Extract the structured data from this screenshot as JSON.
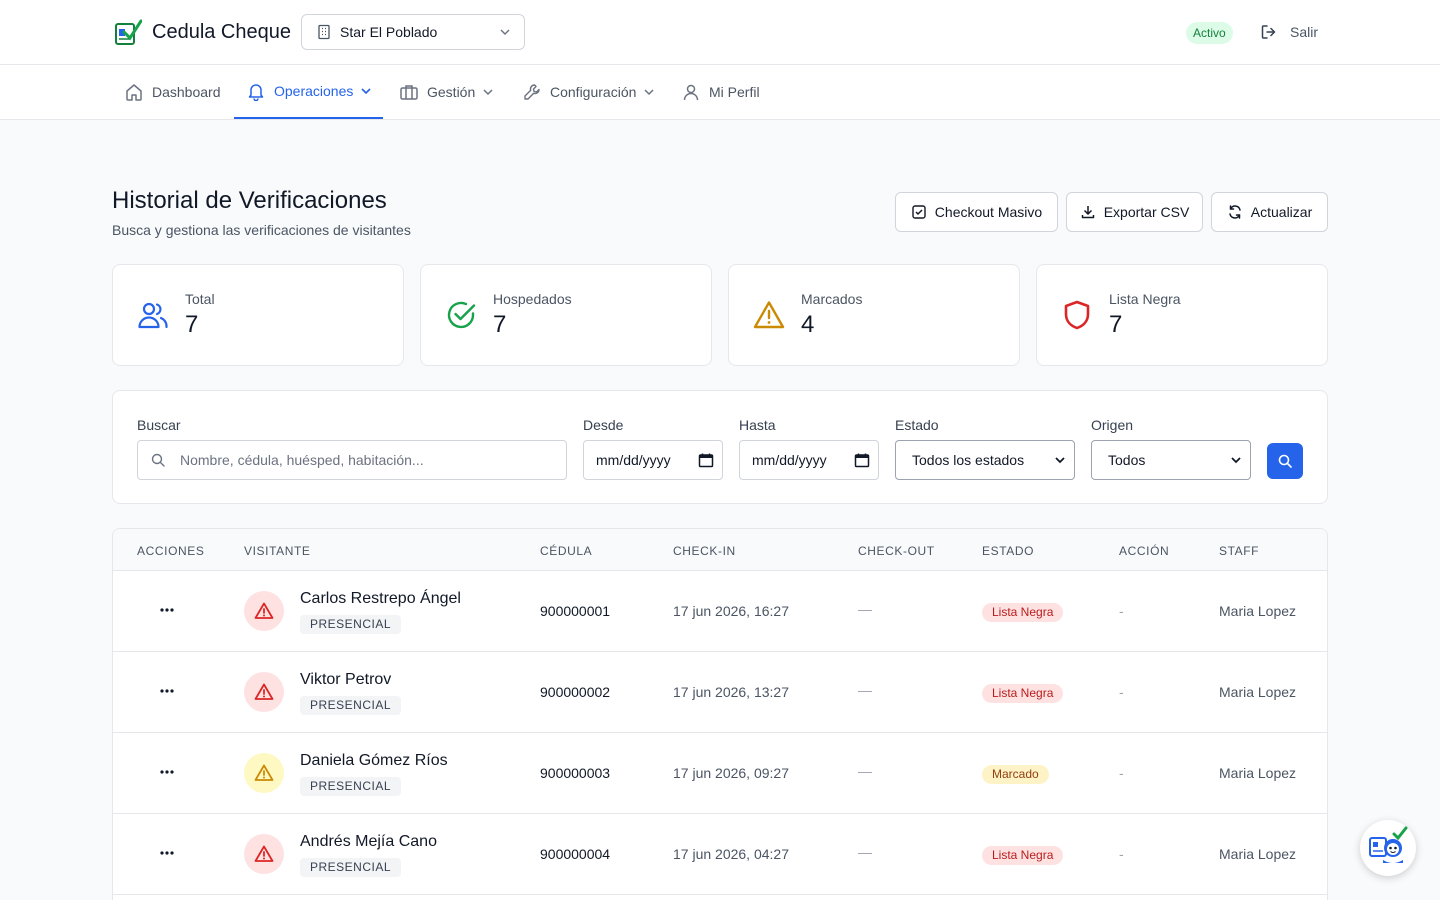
{
  "header": {
    "app_title": "Cedula Cheque",
    "venue": "Star El Poblado",
    "status_badge": "Activo",
    "logout_label": "Salir",
    "icons": {
      "logo": "check-id-logo-icon",
      "venue": "building-icon",
      "logout": "logout-icon"
    }
  },
  "nav": {
    "items": [
      {
        "label": "Dashboard",
        "icon": "home-icon"
      },
      {
        "label": "Operaciones",
        "icon": "bell-icon",
        "active": true
      },
      {
        "label": "Gestión",
        "icon": "briefcase-icon"
      },
      {
        "label": "Configuración",
        "icon": "wrench-icon"
      },
      {
        "label": "Mi Perfil",
        "icon": "user-icon"
      }
    ]
  },
  "page": {
    "title": "Historial de Verificaciones",
    "subtitle": "Busca y gestiona las verificaciones de visitantes",
    "actions": {
      "checkout": "Checkout Masivo",
      "export": "Exportar CSV",
      "refresh": "Actualizar"
    }
  },
  "stats": [
    {
      "label": "Total",
      "value": "7",
      "icon": "users-icon",
      "color": "#2563eb"
    },
    {
      "label": "Hospedados",
      "value": "7",
      "icon": "check-circle-icon",
      "color": "#16a34a"
    },
    {
      "label": "Marcados",
      "value": "4",
      "icon": "warning-icon",
      "color": "#ca8a04"
    },
    {
      "label": "Lista Negra",
      "value": "7",
      "icon": "shield-icon",
      "color": "#dc2626"
    }
  ],
  "filters": {
    "search_label": "Buscar",
    "search_placeholder": "Nombre, cédula, huésped, habitación...",
    "from_label": "Desde",
    "from_value": "mm/dd/yyyy",
    "to_label": "Hasta",
    "to_value": "mm/dd/yyyy",
    "status_label": "Estado",
    "status_value": "Todos los estados",
    "origin_label": "Origen",
    "origin_value": "Todos"
  },
  "table": {
    "headers": [
      "ACCIONES",
      "VISITANTE",
      "CÉDULA",
      "CHECK-IN",
      "CHECK-OUT",
      "ESTADO",
      "ACCIÓN",
      "STAFF"
    ],
    "rows": [
      {
        "name": "Carlos Restrepo Ángel",
        "tag": "PRESENCIAL",
        "cedula": "900000001",
        "checkin": "17 jun 2026, 16:27",
        "checkout": "—",
        "estado": "Lista Negra",
        "estado_kind": "neg",
        "accion": "-",
        "staff": "Maria Lopez"
      },
      {
        "name": "Viktor Petrov",
        "tag": "PRESENCIAL",
        "cedula": "900000002",
        "checkin": "17 jun 2026, 13:27",
        "checkout": "—",
        "estado": "Lista Negra",
        "estado_kind": "neg",
        "accion": "-",
        "staff": "Maria Lopez"
      },
      {
        "name": "Daniela Gómez Ríos",
        "tag": "PRESENCIAL",
        "cedula": "900000003",
        "checkin": "17 jun 2026, 09:27",
        "checkout": "—",
        "estado": "Marcado",
        "estado_kind": "mark",
        "accion": "-",
        "staff": "Maria Lopez"
      },
      {
        "name": "Andrés Mejía Cano",
        "tag": "PRESENCIAL",
        "cedula": "900000004",
        "checkin": "17 jun 2026, 04:27",
        "checkout": "—",
        "estado": "Lista Negra",
        "estado_kind": "neg",
        "accion": "-",
        "staff": "Maria Lopez"
      }
    ]
  },
  "assistant": {
    "icon": "assistant-bot-icon"
  }
}
